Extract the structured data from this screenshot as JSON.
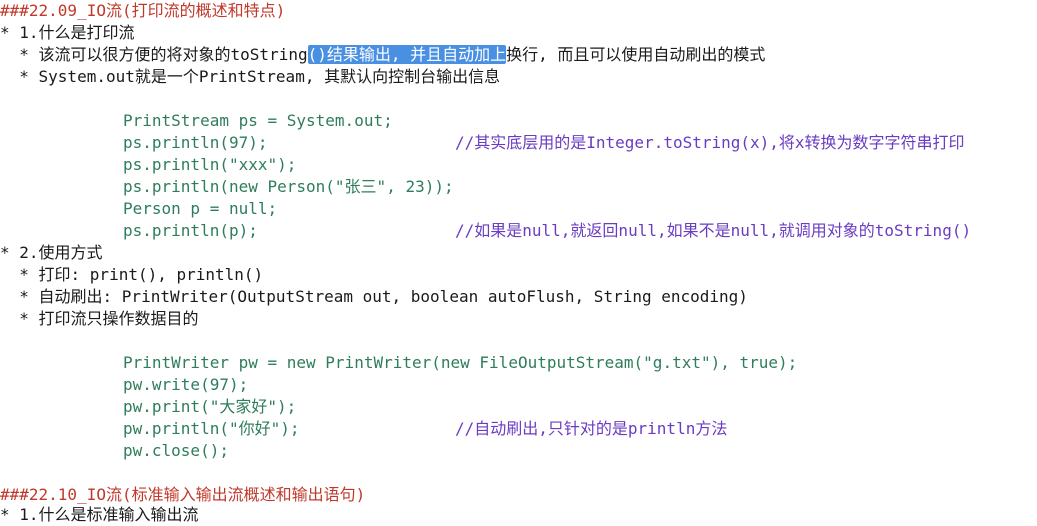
{
  "heading1": "###22.09_IO流(打印流的概述和特点)",
  "s1_title": "* 1.什么是打印流",
  "s1_b1_pre": "  * 该流可以很方便的将对象的toString",
  "s1_b1_hl": "()结果输出, 并且自动加上",
  "s1_b1_post": "换行, 而且可以使用自动刷出的模式",
  "s1_b2": "  * System.out就是一个PrintStream, 其默认向控制台输出信息",
  "code1": [
    {
      "code": "PrintStream ps = System.out;",
      "comment": ""
    },
    {
      "code": "ps.println(97);",
      "comment": "//其实底层用的是Integer.toString(x),将x转换为数字字符串打印"
    },
    {
      "code": "ps.println(\"xxx\");",
      "comment": ""
    },
    {
      "code": "ps.println(new Person(\"张三\", 23));",
      "comment": ""
    },
    {
      "code": "Person p = null;",
      "comment": ""
    },
    {
      "code": "ps.println(p);",
      "comment": "//如果是null,就返回null,如果不是null,就调用对象的toString()"
    }
  ],
  "s2_title": "* 2.使用方式",
  "s2_b1": "  * 打印: print(), println()",
  "s2_b2": "  * 自动刷出: PrintWriter(OutputStream out, boolean autoFlush, String encoding)",
  "s2_b3": "  * 打印流只操作数据目的",
  "code2": [
    {
      "code": "PrintWriter pw = new PrintWriter(new FileOutputStream(\"g.txt\"), true);",
      "comment": ""
    },
    {
      "code": "pw.write(97);",
      "comment": ""
    },
    {
      "code": "pw.print(\"大家好\");",
      "comment": ""
    },
    {
      "code": "pw.println(\"你好\");",
      "comment": "//自动刷出,只针对的是println方法"
    },
    {
      "code": "pw.close();",
      "comment": ""
    }
  ],
  "heading2": "###22.10_IO流(标准输入输出流概述和输出语句)",
  "s3_title": "* 1.什么是标准输入输出流"
}
